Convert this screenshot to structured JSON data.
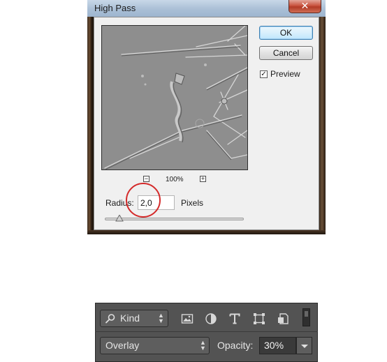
{
  "dialog": {
    "title": "High Pass",
    "close_label": "✕",
    "ok_label": "OK",
    "cancel_label": "Cancel",
    "preview_label": "Preview",
    "preview_checked": true,
    "zoom_level": "100%",
    "zoom_out_label": "−",
    "zoom_in_label": "+",
    "radius_label": "Radius:",
    "radius_value": "2,0",
    "radius_unit": "Pixels",
    "annotation_color": "#d42a2a"
  },
  "layers_panel": {
    "filter_kind": "Kind",
    "filter_icons": [
      "image-icon",
      "adjustment-circle-icon",
      "type-icon",
      "shape-transform-icon",
      "smart-object-icon"
    ],
    "blend_mode": "Overlay",
    "opacity_label": "Opacity:",
    "opacity_value": "30%"
  }
}
